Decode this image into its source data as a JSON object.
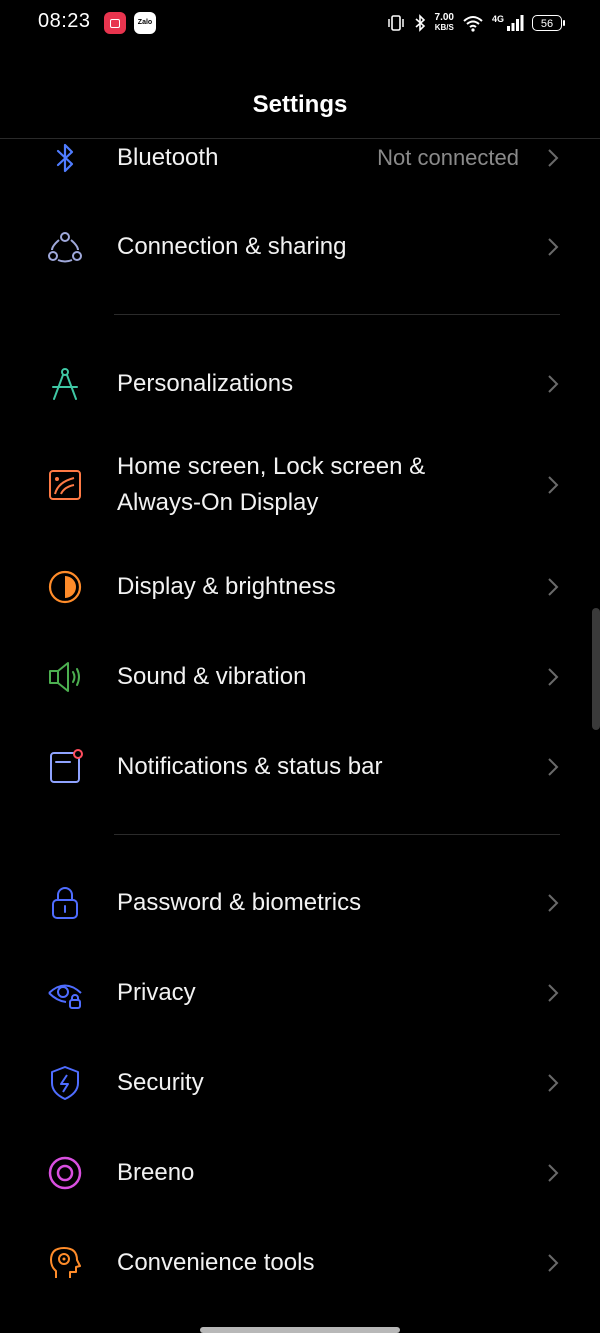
{
  "status_bar": {
    "time": "08:23",
    "notif_app_2": "Zalo",
    "speed_value": "7.00",
    "speed_unit": "KB/S",
    "network": "4G",
    "battery": "56"
  },
  "header": {
    "title": "Settings"
  },
  "items": [
    {
      "label": "Bluetooth",
      "value": "Not connected",
      "icon": "bluetooth-icon"
    },
    {
      "label": "Connection & sharing",
      "icon": "connection-sharing-icon"
    },
    {
      "label": "Personalizations",
      "icon": "compass-icon"
    },
    {
      "label": "Home screen, Lock screen & Always-On Display",
      "icon": "wallpaper-icon"
    },
    {
      "label": "Display & brightness",
      "icon": "brightness-icon"
    },
    {
      "label": "Sound & vibration",
      "icon": "speaker-icon"
    },
    {
      "label": "Notifications & status bar",
      "icon": "notification-icon"
    },
    {
      "label": "Password & biometrics",
      "icon": "lock-icon"
    },
    {
      "label": "Privacy",
      "icon": "privacy-eye-icon"
    },
    {
      "label": "Security",
      "icon": "security-shield-icon"
    },
    {
      "label": "Breeno",
      "icon": "breeno-icon"
    },
    {
      "label": "Convenience tools",
      "icon": "convenience-tools-icon"
    }
  ],
  "colors": {
    "background": "#000000",
    "bluetooth": "#4f7cff",
    "connection": "#9fa8da",
    "personalization": "#3fc7a4",
    "wallpaper": "#ff7a45",
    "brightness": "#ff8c2a",
    "sound": "#4caf50",
    "notification": "#8fa3ff",
    "password": "#4f6dff",
    "privacy": "#4f6dff",
    "security": "#4f6dff",
    "breeno": "#d94fe0",
    "convenience": "#ff8c2a"
  }
}
